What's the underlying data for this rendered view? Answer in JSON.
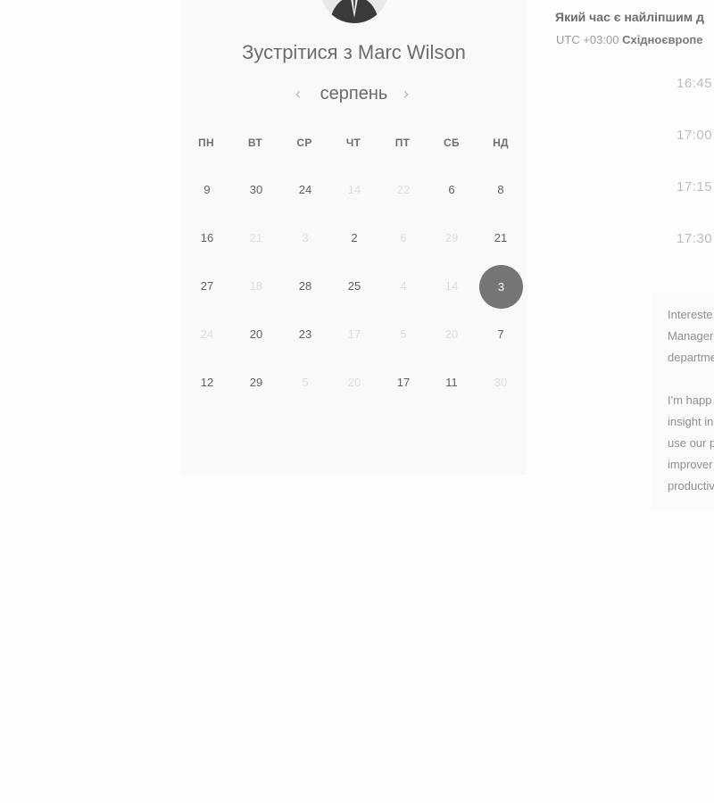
{
  "booking": {
    "title": "Зустрітися з Marc Wilson",
    "month": "серпень",
    "prev_icon": "‹",
    "next_icon": "›",
    "weekdays": [
      "ПН",
      "ВТ",
      "СР",
      "ЧТ",
      "ПТ",
      "СБ",
      "НД"
    ],
    "weeks": [
      [
        {
          "d": "9",
          "on": true
        },
        {
          "d": "30",
          "on": true
        },
        {
          "d": "24",
          "on": true
        },
        {
          "d": "14",
          "on": false
        },
        {
          "d": "22",
          "on": false
        },
        {
          "d": "6",
          "on": true
        },
        {
          "d": "8",
          "on": true
        }
      ],
      [
        {
          "d": "16",
          "on": true
        },
        {
          "d": "21",
          "on": false
        },
        {
          "d": "3",
          "on": false
        },
        {
          "d": "2",
          "on": true
        },
        {
          "d": "6",
          "on": false
        },
        {
          "d": "29",
          "on": false
        },
        {
          "d": "21",
          "on": true
        }
      ],
      [
        {
          "d": "27",
          "on": true
        },
        {
          "d": "18",
          "on": false
        },
        {
          "d": "28",
          "on": true
        },
        {
          "d": "25",
          "on": true
        },
        {
          "d": "4",
          "on": false
        },
        {
          "d": "14",
          "on": false
        },
        {
          "d": "3",
          "on": true,
          "selected": true
        }
      ],
      [
        {
          "d": "24",
          "on": false
        },
        {
          "d": "20",
          "on": true
        },
        {
          "d": "23",
          "on": true
        },
        {
          "d": "17",
          "on": false
        },
        {
          "d": "5",
          "on": false
        },
        {
          "d": "20",
          "on": false
        },
        {
          "d": "7",
          "on": true
        }
      ],
      [
        {
          "d": "12",
          "on": true
        },
        {
          "d": "29",
          "on": true
        },
        {
          "d": "5",
          "on": false
        },
        {
          "d": "20",
          "on": false
        },
        {
          "d": "17",
          "on": true
        },
        {
          "d": "11",
          "on": true
        },
        {
          "d": "30",
          "on": false
        }
      ]
    ]
  },
  "times": {
    "question": "Який час є найліпшим д",
    "tz_offset": "UTC +03:00",
    "tz_name": "Східноєвропе",
    "slots": [
      "16:45",
      "17:00",
      "17:15",
      "17:30"
    ]
  },
  "description": {
    "lines": [
      "Intereste",
      "Manager",
      "departme",
      "",
      "I'm happ",
      "insight in",
      "use our p",
      "improver",
      "productiv"
    ]
  },
  "colors": {
    "selected_day": "#757575",
    "panel_bg": "#f9f9f9"
  },
  "icons": {
    "avatar": "person-photo"
  }
}
